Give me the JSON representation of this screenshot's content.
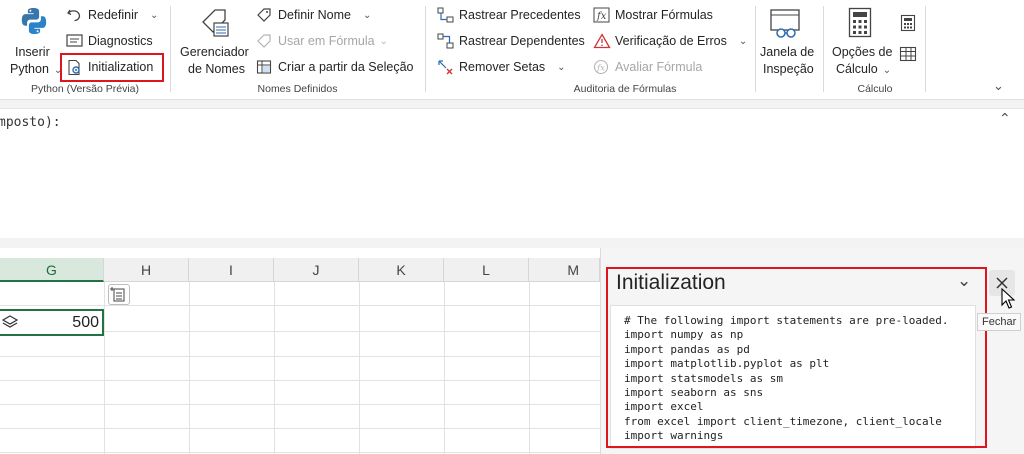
{
  "ribbon": {
    "python_group": {
      "insert_label_line1": "Inserir",
      "insert_label_line2": "Python",
      "redefinir": "Redefinir",
      "diagnostics": "Diagnostics",
      "initialization": "Initialization",
      "group_label": "Python (Versão Prévia)"
    },
    "names_group": {
      "manager_line1": "Gerenciador",
      "manager_line2": "de Nomes",
      "define_name": "Definir Nome",
      "use_in_formula": "Usar em Fórmula",
      "create_from_selection": "Criar a partir da Seleção",
      "group_label": "Nomes Definidos"
    },
    "audit_group": {
      "trace_precedents": "Rastrear Precedentes",
      "trace_dependents": "Rastrear Dependentes",
      "remove_arrows": "Remover Setas",
      "show_formulas": "Mostrar Fórmulas",
      "error_checking": "Verificação de Erros",
      "evaluate_formula": "Avaliar Fórmula",
      "group_label": "Auditoria de Fórmulas"
    },
    "watch": {
      "line1": "Janela de",
      "line2": "Inspeção"
    },
    "calc_group": {
      "options_line1": "Opções de",
      "options_line2": "Cálculo",
      "group_label": "Cálculo"
    }
  },
  "formula_bar": {
    "text": "mposto):"
  },
  "grid": {
    "columns": [
      "G",
      "H",
      "I",
      "J",
      "K",
      "L",
      "M"
    ],
    "selected_column": "G",
    "cell_value": "500"
  },
  "pane": {
    "title": "Initialization",
    "close_tooltip": "Fechar",
    "code": "# The following import statements are pre-loaded.\nimport numpy as np\nimport pandas as pd\nimport matplotlib.pyplot as plt\nimport statsmodels as sm\nimport seaborn as sns\nimport excel\nfrom excel import client_timezone, client_locale\nimport warnings"
  },
  "colors": {
    "highlight": "#e0141e",
    "excel_green": "#217346"
  }
}
